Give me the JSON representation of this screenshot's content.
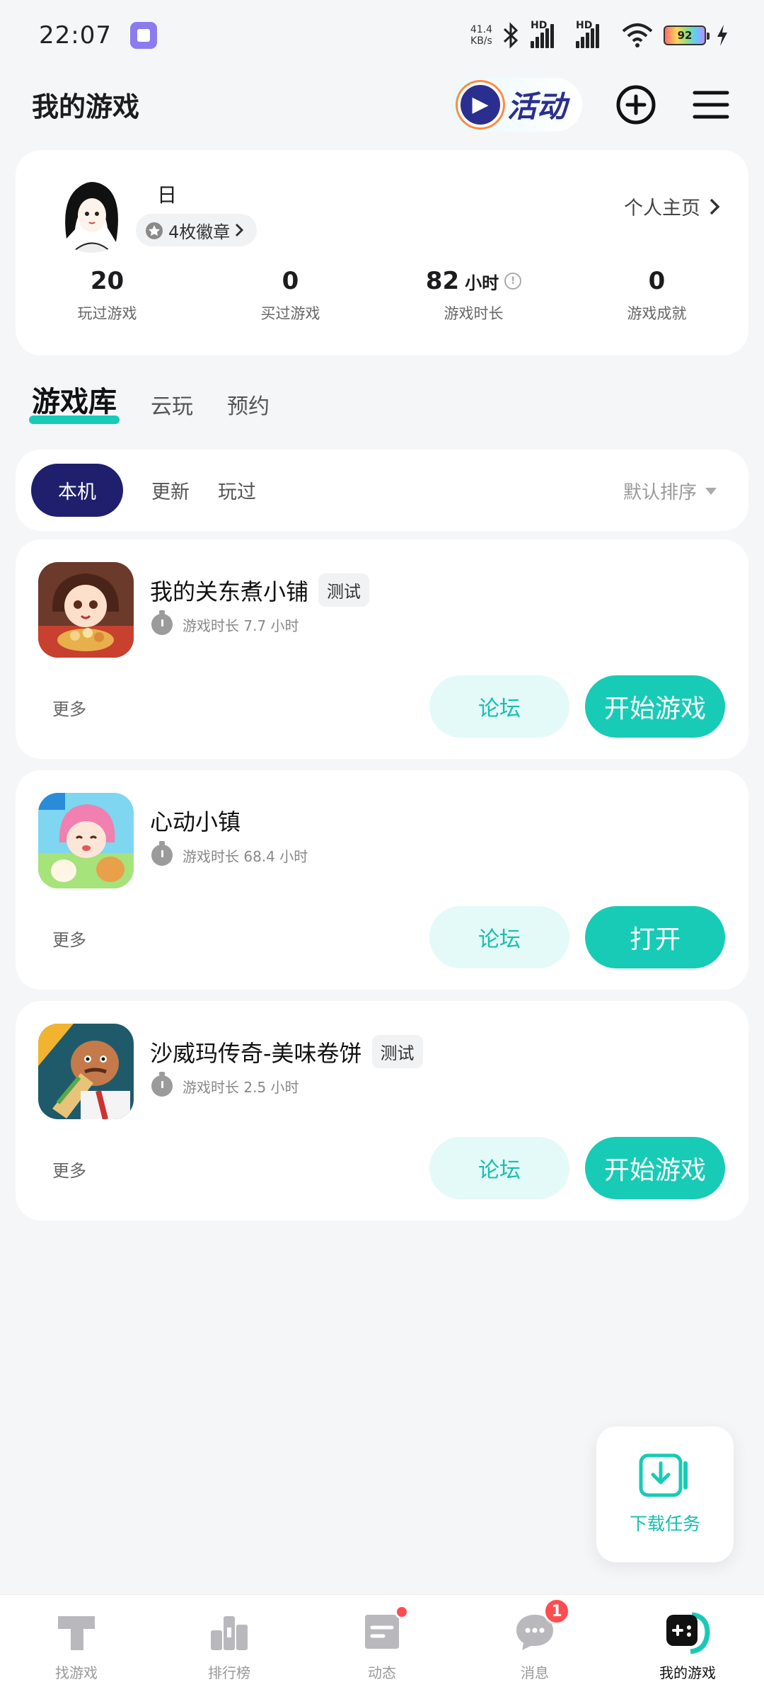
{
  "status_bar": {
    "time": "22:07",
    "net_speed_value": "41.4",
    "net_speed_unit": "KB/s",
    "hd1": "HD",
    "hd2": "HD",
    "battery": "92"
  },
  "header": {
    "title": "我的游戏",
    "activity_label": "活动"
  },
  "profile": {
    "name": "日",
    "badges": "4枚徽章",
    "homepage_link": "个人主页",
    "stats": [
      {
        "value": "20",
        "unit": "",
        "label": "玩过游戏"
      },
      {
        "value": "0",
        "unit": "",
        "label": "买过游戏"
      },
      {
        "value": "82",
        "unit": "小时",
        "label": "游戏时长"
      },
      {
        "value": "0",
        "unit": "",
        "label": "游戏成就"
      }
    ]
  },
  "tabs": [
    "游戏库",
    "云玩",
    "预约"
  ],
  "filters": {
    "chips": [
      "本机",
      "更新",
      "玩过"
    ],
    "sort": "默认排序"
  },
  "games": [
    {
      "name": "我的关东煮小铺",
      "tag": "测试",
      "playtime": "游戏时长 7.7 小时",
      "more": "更多",
      "forum": "论坛",
      "action": "开始游戏"
    },
    {
      "name": "心动小镇",
      "tag": "",
      "playtime": "游戏时长 68.4 小时",
      "more": "更多",
      "forum": "论坛",
      "action": "打开"
    },
    {
      "name": "沙威玛传奇-美味卷饼",
      "tag": "测试",
      "playtime": "游戏时长 2.5 小时",
      "more": "更多",
      "forum": "论坛",
      "action": "开始游戏"
    }
  ],
  "download_task": "下载任务",
  "bottom_nav": [
    {
      "label": "找游戏"
    },
    {
      "label": "排行榜"
    },
    {
      "label": "动态"
    },
    {
      "label": "消息",
      "count": "1"
    },
    {
      "label": "我的游戏"
    }
  ],
  "colors": {
    "accent": "#17cbb6",
    "chip_active": "#1f1f6e",
    "forum_bg": "#e3faf8",
    "badge_red": "#ff4d4f"
  }
}
